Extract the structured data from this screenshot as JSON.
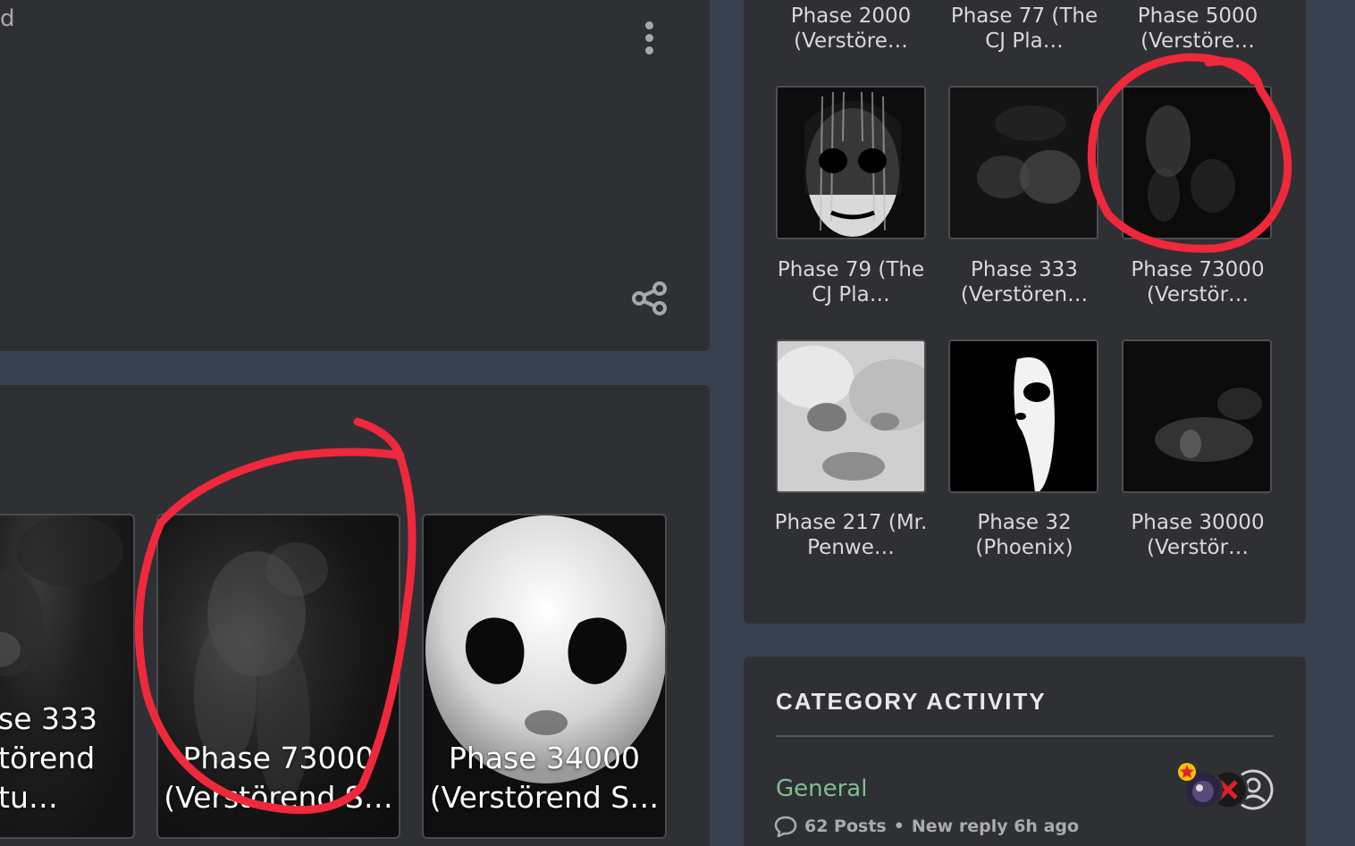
{
  "left_top": {
    "partial_title": "d"
  },
  "left_thumbs": [
    {
      "label": "se 333\ntörend\ntu…"
    },
    {
      "label": "Phase 73000\n(Verstörend S…"
    },
    {
      "label": "Phase 34000\n(Verstörend S…"
    }
  ],
  "right_grid": {
    "top_row_labels": [
      "Phase 2000\n(Verstöre…",
      "Phase 77 (The\nCJ Pla…",
      "Phase 5000\n(Verstöre…"
    ],
    "row1_labels": [
      "Phase 79 (The\nCJ Pla…",
      "Phase 333\n(Verstören…",
      "Phase 73000\n(Verstör…"
    ],
    "row2_labels": [
      "Phase 217 (Mr.\nPenwe…",
      "Phase 32\n(Phoenix)",
      "Phase 30000\n(Verstör…"
    ]
  },
  "category_activity": {
    "title": "CATEGORY ACTIVITY",
    "category_name": "General",
    "posts": "62 Posts",
    "separator": "•",
    "last_reply": "New reply 6h ago"
  },
  "icons": {
    "menu": "kebab-menu-icon",
    "share": "share-icon",
    "comment": "comment-icon"
  },
  "colors": {
    "page_bg": "#394150",
    "card_bg": "#2f3033",
    "category_green": "#7fbf93",
    "annotation_red": "#f0283c"
  }
}
